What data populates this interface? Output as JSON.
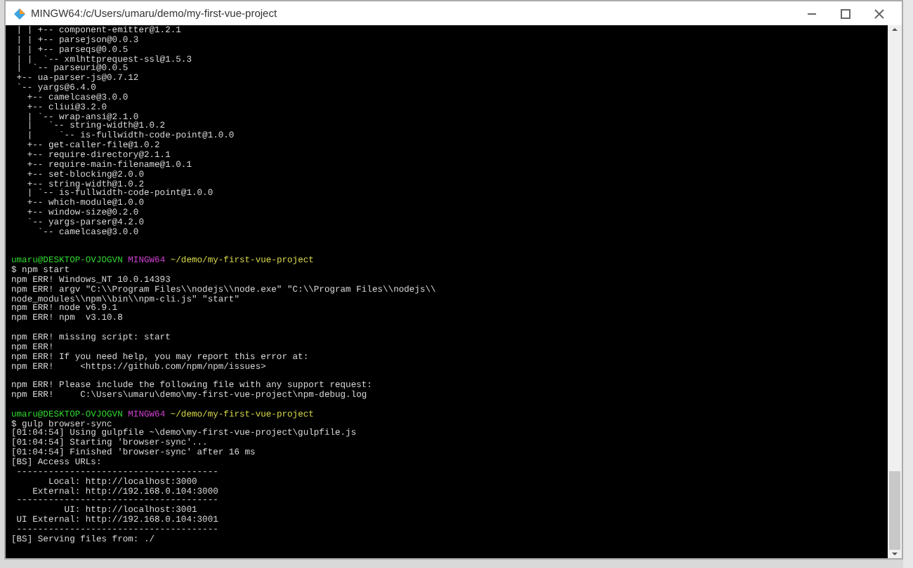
{
  "window": {
    "title": "MINGW64:/c/Users/umaru/demo/my-first-vue-project"
  },
  "terminal": {
    "lines": [
      {
        "kind": "text",
        "text": " | | +-- component-emitter@1.2.1"
      },
      {
        "kind": "text",
        "text": " | | +-- parsejson@0.0.3"
      },
      {
        "kind": "text",
        "text": " | | +-- parseqs@0.0.5"
      },
      {
        "kind": "text",
        "text": " | |  `-- xmlhttprequest-ssl@1.5.3"
      },
      {
        "kind": "text",
        "text": " |  `-- parseuri@0.0.5"
      },
      {
        "kind": "text",
        "text": " +-- ua-parser-js@0.7.12"
      },
      {
        "kind": "text",
        "text": " `-- yargs@6.4.0"
      },
      {
        "kind": "text",
        "text": "   +-- camelcase@3.0.0"
      },
      {
        "kind": "text",
        "text": "   +-- cliui@3.2.0"
      },
      {
        "kind": "text",
        "text": "   | `-- wrap-ansi@2.1.0"
      },
      {
        "kind": "text",
        "text": "   |   `-- string-width@1.0.2"
      },
      {
        "kind": "text",
        "text": "   |     `-- is-fullwidth-code-point@1.0.0"
      },
      {
        "kind": "text",
        "text": "   +-- get-caller-file@1.0.2"
      },
      {
        "kind": "text",
        "text": "   +-- require-directory@2.1.1"
      },
      {
        "kind": "text",
        "text": "   +-- require-main-filename@1.0.1"
      },
      {
        "kind": "text",
        "text": "   +-- set-blocking@2.0.0"
      },
      {
        "kind": "text",
        "text": "   +-- string-width@1.0.2"
      },
      {
        "kind": "text",
        "text": "   | `-- is-fullwidth-code-point@1.0.0"
      },
      {
        "kind": "text",
        "text": "   +-- which-module@1.0.0"
      },
      {
        "kind": "text",
        "text": "   +-- window-size@0.2.0"
      },
      {
        "kind": "text",
        "text": "   `-- yargs-parser@4.2.0"
      },
      {
        "kind": "text",
        "text": "     `-- camelcase@3.0.0"
      },
      {
        "kind": "blank"
      },
      {
        "kind": "blank"
      },
      {
        "kind": "prompt",
        "user": "umaru@DESKTOP-OVJOGVN",
        "system": "MINGW64",
        "path": "~/demo/my-first-vue-project"
      },
      {
        "kind": "text",
        "text": "$ npm start"
      },
      {
        "kind": "text",
        "text": "npm ERR! Windows_NT 10.0.14393"
      },
      {
        "kind": "text",
        "text": "npm ERR! argv \"C:\\\\Program Files\\\\nodejs\\\\node.exe\" \"C:\\\\Program Files\\\\nodejs\\\\"
      },
      {
        "kind": "text",
        "text": "node_modules\\\\npm\\\\bin\\\\npm-cli.js\" \"start\""
      },
      {
        "kind": "text",
        "text": "npm ERR! node v6.9.1"
      },
      {
        "kind": "text",
        "text": "npm ERR! npm  v3.10.8"
      },
      {
        "kind": "blank"
      },
      {
        "kind": "text",
        "text": "npm ERR! missing script: start"
      },
      {
        "kind": "text",
        "text": "npm ERR!"
      },
      {
        "kind": "text",
        "text": "npm ERR! If you need help, you may report this error at:"
      },
      {
        "kind": "text",
        "text": "npm ERR!     <https://github.com/npm/npm/issues>"
      },
      {
        "kind": "blank"
      },
      {
        "kind": "text",
        "text": "npm ERR! Please include the following file with any support request:"
      },
      {
        "kind": "text",
        "text": "npm ERR!     C:\\Users\\umaru\\demo\\my-first-vue-project\\npm-debug.log"
      },
      {
        "kind": "blank"
      },
      {
        "kind": "prompt",
        "user": "umaru@DESKTOP-OVJOGVN",
        "system": "MINGW64",
        "path": "~/demo/my-first-vue-project"
      },
      {
        "kind": "text",
        "text": "$ gulp browser-sync"
      },
      {
        "kind": "text",
        "text": "[01:04:54] Using gulpfile ~\\demo\\my-first-vue-project\\gulpfile.js"
      },
      {
        "kind": "text",
        "text": "[01:04:54] Starting 'browser-sync'..."
      },
      {
        "kind": "text",
        "text": "[01:04:54] Finished 'browser-sync' after 16 ms"
      },
      {
        "kind": "text",
        "text": "[BS] Access URLs:"
      },
      {
        "kind": "text",
        "text": " --------------------------------------"
      },
      {
        "kind": "text",
        "text": "       Local: http://localhost:3000"
      },
      {
        "kind": "text",
        "text": "    External: http://192.168.0.104:3000"
      },
      {
        "kind": "text",
        "text": " --------------------------------------"
      },
      {
        "kind": "text",
        "text": "          UI: http://localhost:3001"
      },
      {
        "kind": "text",
        "text": " UI External: http://192.168.0.104:3001"
      },
      {
        "kind": "text",
        "text": " --------------------------------------"
      },
      {
        "kind": "text",
        "text": "[BS] Serving files from: ./"
      }
    ]
  }
}
